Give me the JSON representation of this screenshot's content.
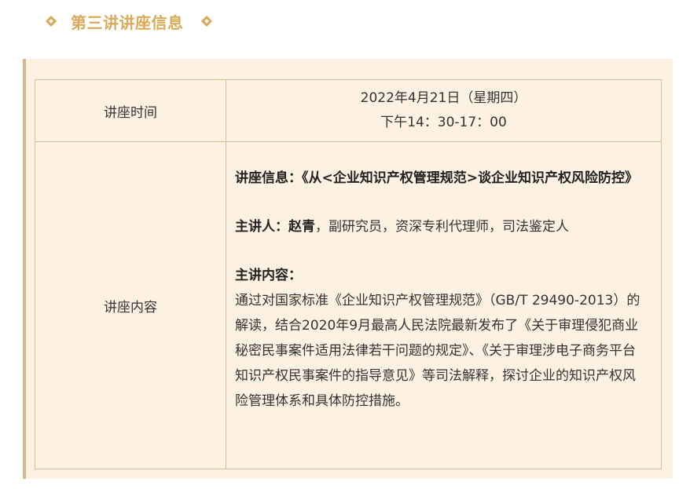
{
  "section": {
    "title": "第三讲讲座信息"
  },
  "table": {
    "time_label": "讲座时间",
    "time_line1": "2022年4月21日（星期四）",
    "time_line2": "下午14：30-17：00",
    "content_label": "讲座内容",
    "lecture_info_label": "讲座信息：",
    "lecture_info_value": "《从<企业知识产权管理规范>谈企业知识产权风险防控》",
    "speaker_label": "主讲人：",
    "speaker_name": "赵青",
    "speaker_desc": "，副研究员，资深专利代理师，司法鉴定人",
    "content_heading": "主讲内容：",
    "content_text": "通过对国家标准《企业知识产权管理规范》（GB/T 29490-2013）的解读，结合2020年9月最高人民法院最新发布了《关于审理侵犯商业秘密民事案件适用法律若干问题的规定》、《关于审理涉电子商务平台知识产权民事案件的指导意见》等司法解释，探讨企业的知识产权风险管理体系和具体防控措施。"
  },
  "colors": {
    "accent": "#d9aa5a",
    "panel_bg": "#fdf2e2",
    "border": "#d8bd96"
  }
}
